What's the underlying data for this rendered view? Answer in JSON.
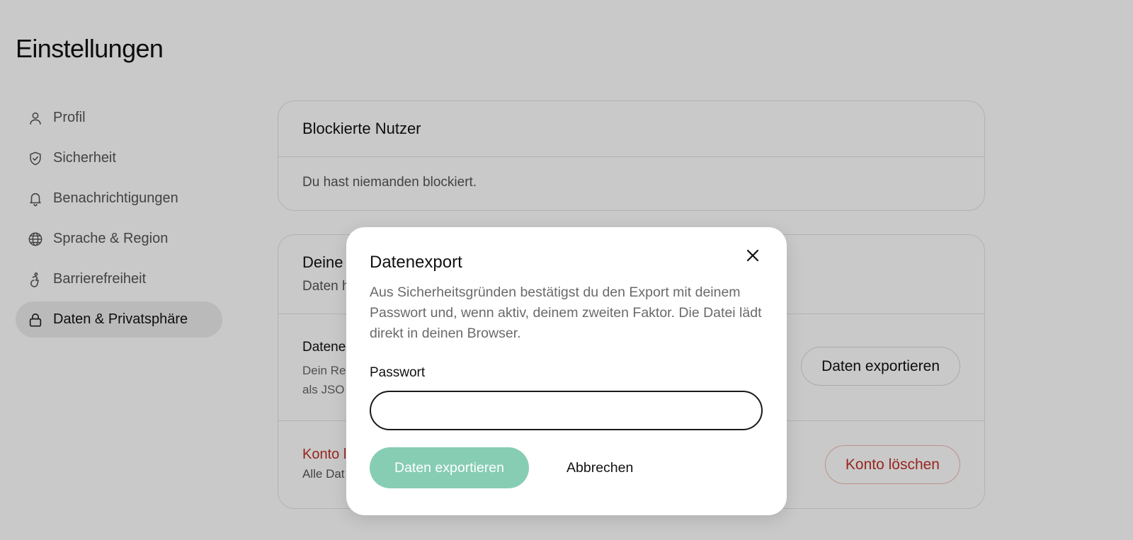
{
  "page": {
    "title": "Einstellungen"
  },
  "sidebar": {
    "items": [
      {
        "label": "Profil",
        "icon": "user-icon",
        "active": false
      },
      {
        "label": "Sicherheit",
        "icon": "shield-check-icon",
        "active": false
      },
      {
        "label": "Benachrichtigungen",
        "icon": "bell-icon",
        "active": false
      },
      {
        "label": "Sprache & Region",
        "icon": "globe-icon",
        "active": false
      },
      {
        "label": "Barrierefreiheit",
        "icon": "accessibility-icon",
        "active": false
      },
      {
        "label": "Daten & Privatsphäre",
        "icon": "lock-icon",
        "active": true
      }
    ]
  },
  "blocked_card": {
    "title": "Blockierte Nutzer",
    "empty_text": "Du hast niemanden blockiert."
  },
  "data_card": {
    "title_partial": "Deine",
    "subtitle_partial": "Daten h",
    "export_row": {
      "title_partial": "Datene",
      "desc_line1_partial": "Dein Re",
      "desc_line2_partial": "als JSO",
      "button_label": "Daten exportieren"
    },
    "delete_row": {
      "title_partial": "Konto l",
      "desc_partial": "Alle Dat",
      "button_label": "Konto löschen"
    }
  },
  "modal": {
    "title": "Datenexport",
    "description": "Aus Sicherheitsgründen bestätigst du den Export mit deinem Passwort und, wenn aktiv, deinem zweiten Faktor. Die Datei lädt direkt in deinen Browser.",
    "password_label": "Passwort",
    "password_value": "",
    "primary_button": "Daten exportieren",
    "cancel_button": "Abbrechen",
    "close_icon": "close-icon"
  },
  "colors": {
    "accent_disabled": "#86cdb4",
    "danger": "#c0312b",
    "overlay": "rgba(0,0,0,0.21)"
  }
}
